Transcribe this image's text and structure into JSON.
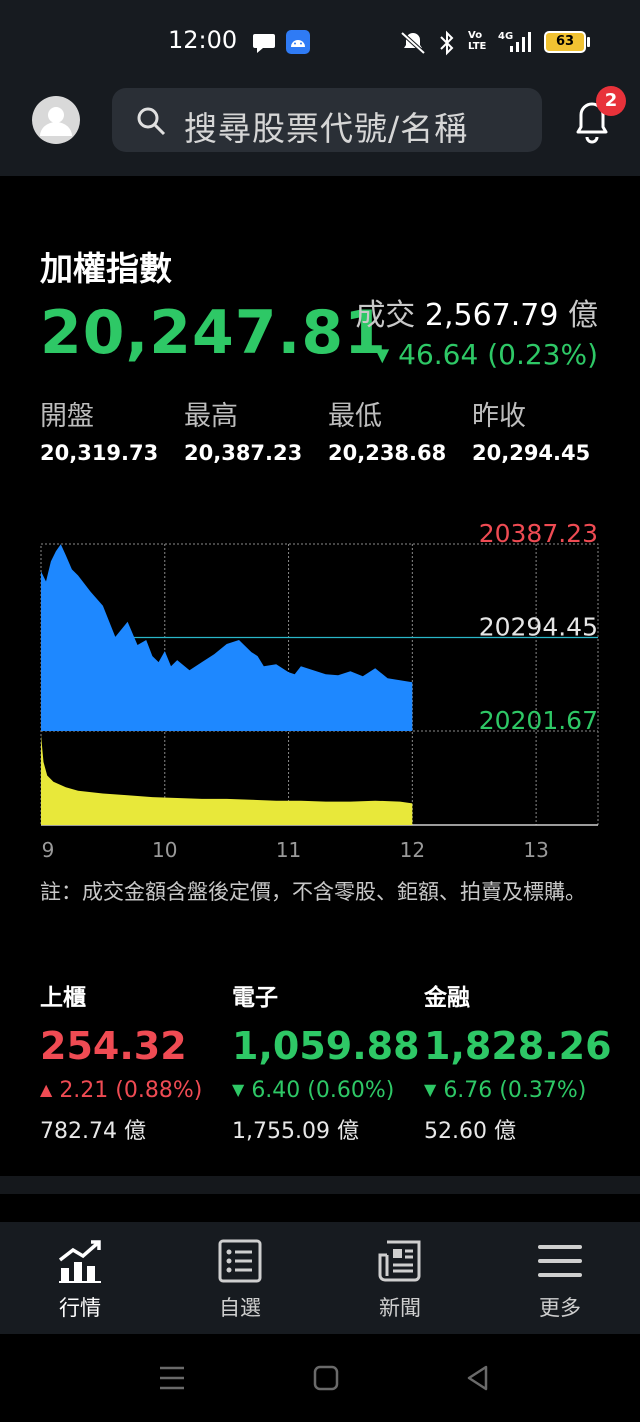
{
  "status_bar": {
    "time": "12:00",
    "battery": "63"
  },
  "header": {
    "search_placeholder": "搜尋股票代號/名稱",
    "notification_count": "2"
  },
  "index": {
    "name": "加權指數",
    "value": "20,247.81",
    "volume_label": "成交",
    "volume_value": "2,567.79",
    "volume_unit": "億",
    "change": "46.64 (0.23%)",
    "stats": [
      {
        "label": "開盤",
        "value": "20,319.73"
      },
      {
        "label": "最高",
        "value": "20,387.23"
      },
      {
        "label": "最低",
        "value": "20,238.68"
      },
      {
        "label": "昨收",
        "value": "20,294.45"
      }
    ]
  },
  "chart_data": {
    "type": "area",
    "title": "",
    "y_labels": {
      "high": "20387.23",
      "ref": "20294.45",
      "low": "20201.67"
    },
    "ylim": [
      20201.67,
      20387.23
    ],
    "x_ticks": [
      "9",
      "10",
      "11",
      "12",
      "13"
    ],
    "price_series": {
      "name": "",
      "x": [
        9.0,
        9.04,
        9.08,
        9.12,
        9.16,
        9.2,
        9.25,
        9.3,
        9.4,
        9.5,
        9.6,
        9.7,
        9.78,
        9.85,
        9.9,
        9.95,
        10.0,
        10.05,
        10.1,
        10.2,
        10.3,
        10.4,
        10.5,
        10.6,
        10.7,
        10.75,
        10.8,
        10.9,
        11.0,
        11.05,
        11.1,
        11.2,
        11.3,
        11.4,
        11.5,
        11.6,
        11.7,
        11.8,
        11.9,
        12.0
      ],
      "values": [
        20360,
        20350,
        20370,
        20380,
        20387,
        20376,
        20362,
        20356,
        20340,
        20326,
        20295,
        20310,
        20287,
        20292,
        20276,
        20270,
        20281,
        20266,
        20272,
        20262,
        20270,
        20278,
        20288,
        20292,
        20280,
        20276,
        20266,
        20268,
        20260,
        20258,
        20266,
        20262,
        20258,
        20257,
        20261,
        20256,
        20264,
        20254,
        20252,
        20250
      ]
    },
    "volume_series": {
      "name": "",
      "x": [
        9.0,
        9.02,
        9.05,
        9.1,
        9.2,
        9.3,
        9.5,
        9.7,
        9.9,
        10.1,
        10.3,
        10.5,
        10.7,
        10.9,
        11.1,
        11.3,
        11.5,
        11.7,
        11.9,
        12.0
      ],
      "values": [
        100,
        70,
        55,
        48,
        42,
        38,
        35,
        33,
        31,
        30,
        29,
        29,
        28,
        27,
        27,
        26,
        26,
        27,
        26,
        24
      ]
    }
  },
  "note": "註：成交金額含盤後定價，不含零股、鉅額、拍賣及標購。",
  "sub_indices": [
    {
      "name": "上櫃",
      "value": "254.32",
      "direction": "up",
      "change": "2.21 (0.88%)",
      "amount": "782.74 億",
      "color": "#ef4b53"
    },
    {
      "name": "電子",
      "value": "1,059.88",
      "direction": "down",
      "change": "6.40 (0.60%)",
      "amount": "1,755.09 億",
      "color": "#2ec866"
    },
    {
      "name": "金融",
      "value": "1,828.26",
      "direction": "down",
      "change": "6.76 (0.37%)",
      "amount": "52.60 億",
      "color": "#2ec866"
    }
  ],
  "tabs": [
    {
      "label": "行情",
      "icon": "chart-trend-icon",
      "active": true
    },
    {
      "label": "自選",
      "icon": "watchlist-icon",
      "active": false
    },
    {
      "label": "新聞",
      "icon": "news-icon",
      "active": false
    },
    {
      "label": "更多",
      "icon": "menu-icon",
      "active": false
    }
  ],
  "colors": {
    "up": "#ef4b53",
    "down": "#2ec866",
    "price_fill": "#1e88ff",
    "volume_fill": "#e8e83a",
    "ref_line": "#29b6c8"
  }
}
